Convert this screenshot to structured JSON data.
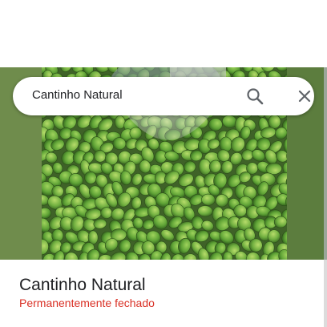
{
  "search": {
    "query": "Cantinho Natural"
  },
  "icons": {
    "search": "search-icon",
    "close": "close-icon"
  },
  "photo": {
    "subject": "green coated peanuts"
  },
  "place": {
    "name": "Cantinho Natural",
    "status": "Permanentemente fechado"
  },
  "colors": {
    "status_closed": "#d93025",
    "icon_gray": "#5f6368"
  }
}
